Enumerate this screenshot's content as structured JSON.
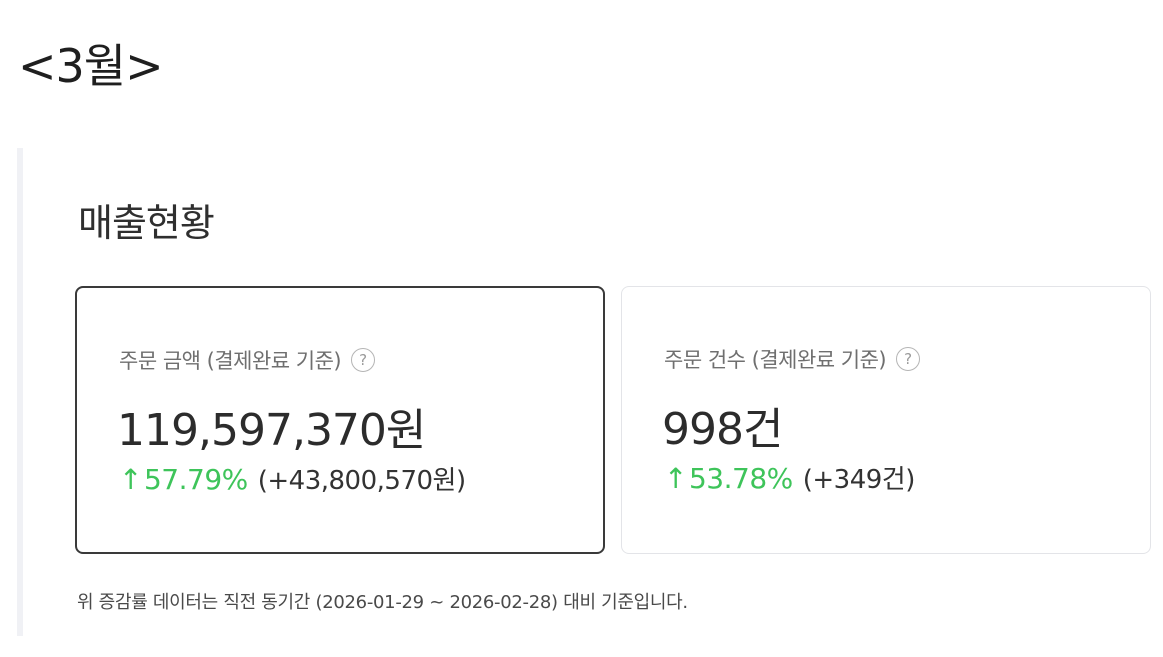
{
  "header": {
    "month_title": "<3월>"
  },
  "sales_panel": {
    "title": "매출현황",
    "cards": [
      {
        "label": "주문 금액 (결제완료 기준)",
        "help": "?",
        "value": "119,597,370원",
        "change_pct": "57.79%",
        "change_diff": "(+43,800,570원)",
        "arrow": "↑"
      },
      {
        "label": "주문 건수 (결제완료 기준)",
        "help": "?",
        "value": "998건",
        "change_pct": "53.78%",
        "change_diff": "(+349건)",
        "arrow": "↑"
      }
    ],
    "footnote": "위 증감률 데이터는 직전 동기간 (2026-01-29 ~ 2026-02-28) 대비 기준입니다."
  },
  "colors": {
    "positive": "#3ec45a",
    "selected_border": "#3a3a3a",
    "card_border": "#e3e4e8"
  },
  "icons": {
    "help": "question-circle-icon",
    "up": "arrow-up-icon"
  }
}
